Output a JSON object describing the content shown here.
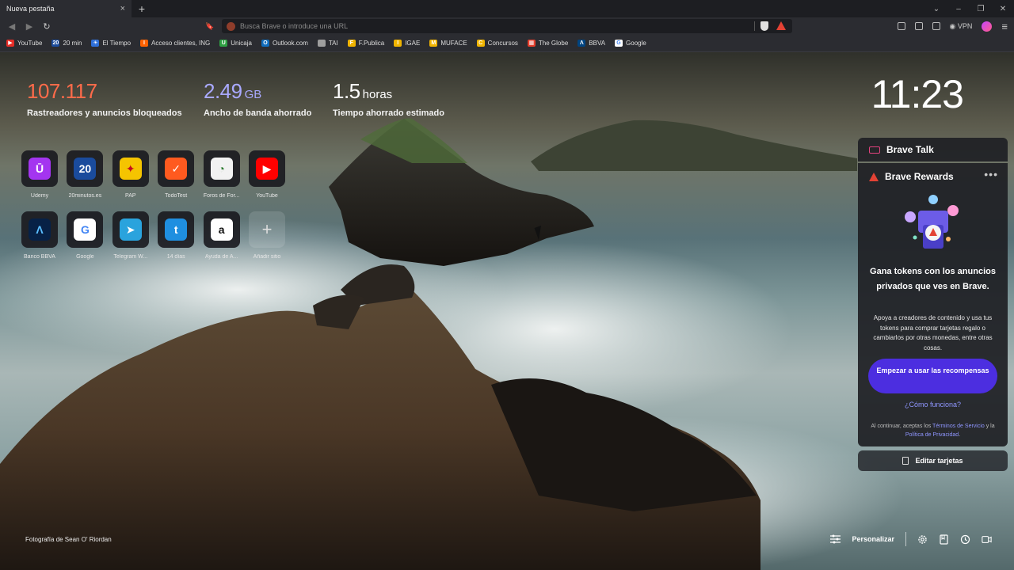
{
  "tab": {
    "title": "Nueva pestaña",
    "close": "×",
    "new": "+"
  },
  "window": {
    "chevron": "⌄",
    "minimize": "–",
    "restore": "❐",
    "close": "✕"
  },
  "nav": {
    "back": "◀",
    "forward": "▶",
    "reload": "↻",
    "bookmark": "🔖"
  },
  "search": {
    "placeholder": "Busca Brave o introduce una URL"
  },
  "toolbar": {
    "vpn": "VPN",
    "menu": "≡"
  },
  "bookmarks": [
    {
      "label": "YouTube",
      "color": "#e52d27",
      "glyph": "▶"
    },
    {
      "label": "20 min",
      "color": "#1a4b9c",
      "glyph": "20"
    },
    {
      "label": "El Tiempo",
      "color": "#2e6fd8",
      "glyph": "☀"
    },
    {
      "label": "Acceso clientes, ING",
      "color": "#ff6200",
      "glyph": "I"
    },
    {
      "label": "Unicaja",
      "color": "#2ea043",
      "glyph": "U"
    },
    {
      "label": "Outlook.com",
      "color": "#0f6cbd",
      "glyph": "O"
    },
    {
      "label": "TAI",
      "color": "#9e9e9e",
      "glyph": ""
    },
    {
      "label": "F.Publica",
      "color": "#f0b400",
      "glyph": "F"
    },
    {
      "label": "IGAE",
      "color": "#f0b400",
      "glyph": "I"
    },
    {
      "label": "MUFACE",
      "color": "#f0b400",
      "glyph": "M"
    },
    {
      "label": "Concursos",
      "color": "#f0b400",
      "glyph": "C"
    },
    {
      "label": "The Globe",
      "color": "#e63e2c",
      "glyph": "▦"
    },
    {
      "label": "BBVA",
      "color": "#004481",
      "glyph": "Λ"
    },
    {
      "label": "Google",
      "color": "#ffffff",
      "glyph": "G"
    }
  ],
  "stats": [
    {
      "value": "107.117",
      "unit": "",
      "label": "Rastreadores y anuncios bloqueados",
      "color": "#ff6b4a"
    },
    {
      "value": "2.49",
      "unit": "GB",
      "label": "Ancho de banda ahorrado",
      "color": "#a9a9ff"
    },
    {
      "value": "1.5",
      "unit": "horas",
      "label": "Tiempo ahorrado estimado",
      "color": "#ffffff"
    }
  ],
  "clock": "11:23",
  "top_sites": [
    {
      "name": "Udemy",
      "glyph": "Ū",
      "bg": "#a435f0",
      "fg": "#ffffff"
    },
    {
      "name": "20minutos.es",
      "glyph": "20",
      "bg": "#1a4b9c",
      "fg": "#ffffff"
    },
    {
      "name": "PAP",
      "glyph": "✦",
      "bg": "#f5c400",
      "fg": "#c60b1e"
    },
    {
      "name": "TodoTest",
      "glyph": "✓",
      "bg": "#ff5a1f",
      "fg": "#ffffff"
    },
    {
      "name": "Foros de For...",
      "glyph": "◔",
      "bg": "#f2f2f2",
      "fg": "#2e7d32"
    },
    {
      "name": "YouTube",
      "glyph": "▶",
      "bg": "#ff0000",
      "fg": "#ffffff"
    },
    {
      "name": "Banco BBVA",
      "glyph": "Λ",
      "bg": "#072146",
      "fg": "#5bbeff"
    },
    {
      "name": "Google",
      "glyph": "G",
      "bg": "#ffffff",
      "fg": "#4285f4"
    },
    {
      "name": "Telegram W...",
      "glyph": "➤",
      "bg": "#2aa3dd",
      "fg": "#ffffff"
    },
    {
      "name": "14 días",
      "glyph": "t",
      "bg": "#1f8fe0",
      "fg": "#ffffff"
    },
    {
      "name": "Ayuda de A...",
      "glyph": "a",
      "bg": "#ffffff",
      "fg": "#111111"
    },
    {
      "name": "Añadir sitio",
      "glyph": "+",
      "bg": "",
      "fg": "#dddddd"
    }
  ],
  "brave_talk": {
    "title": "Brave Talk"
  },
  "brave_rewards": {
    "title": "Brave Rewards",
    "more": "•••",
    "headline": "Gana tokens con los anuncios privados que ves en Brave.",
    "body": "Apoya a creadores de contenido y usa tus tokens para comprar tarjetas regalo o cambiarlos por otras monedas, entre otras cosas.",
    "cta": "Empezar a usar las recompensas",
    "how": "¿Cómo funciona?",
    "terms_prefix": "Al continuar, aceptas los ",
    "terms_link": "Términos de Servicio",
    "terms_mid": " y la ",
    "privacy_link": "Política de Privacidad",
    "terms_suffix": "."
  },
  "edit_cards": "Editar tarjetas",
  "photo_credit": "Fotografía de Sean O' Riordan",
  "footer": {
    "customize": "Personalizar"
  }
}
